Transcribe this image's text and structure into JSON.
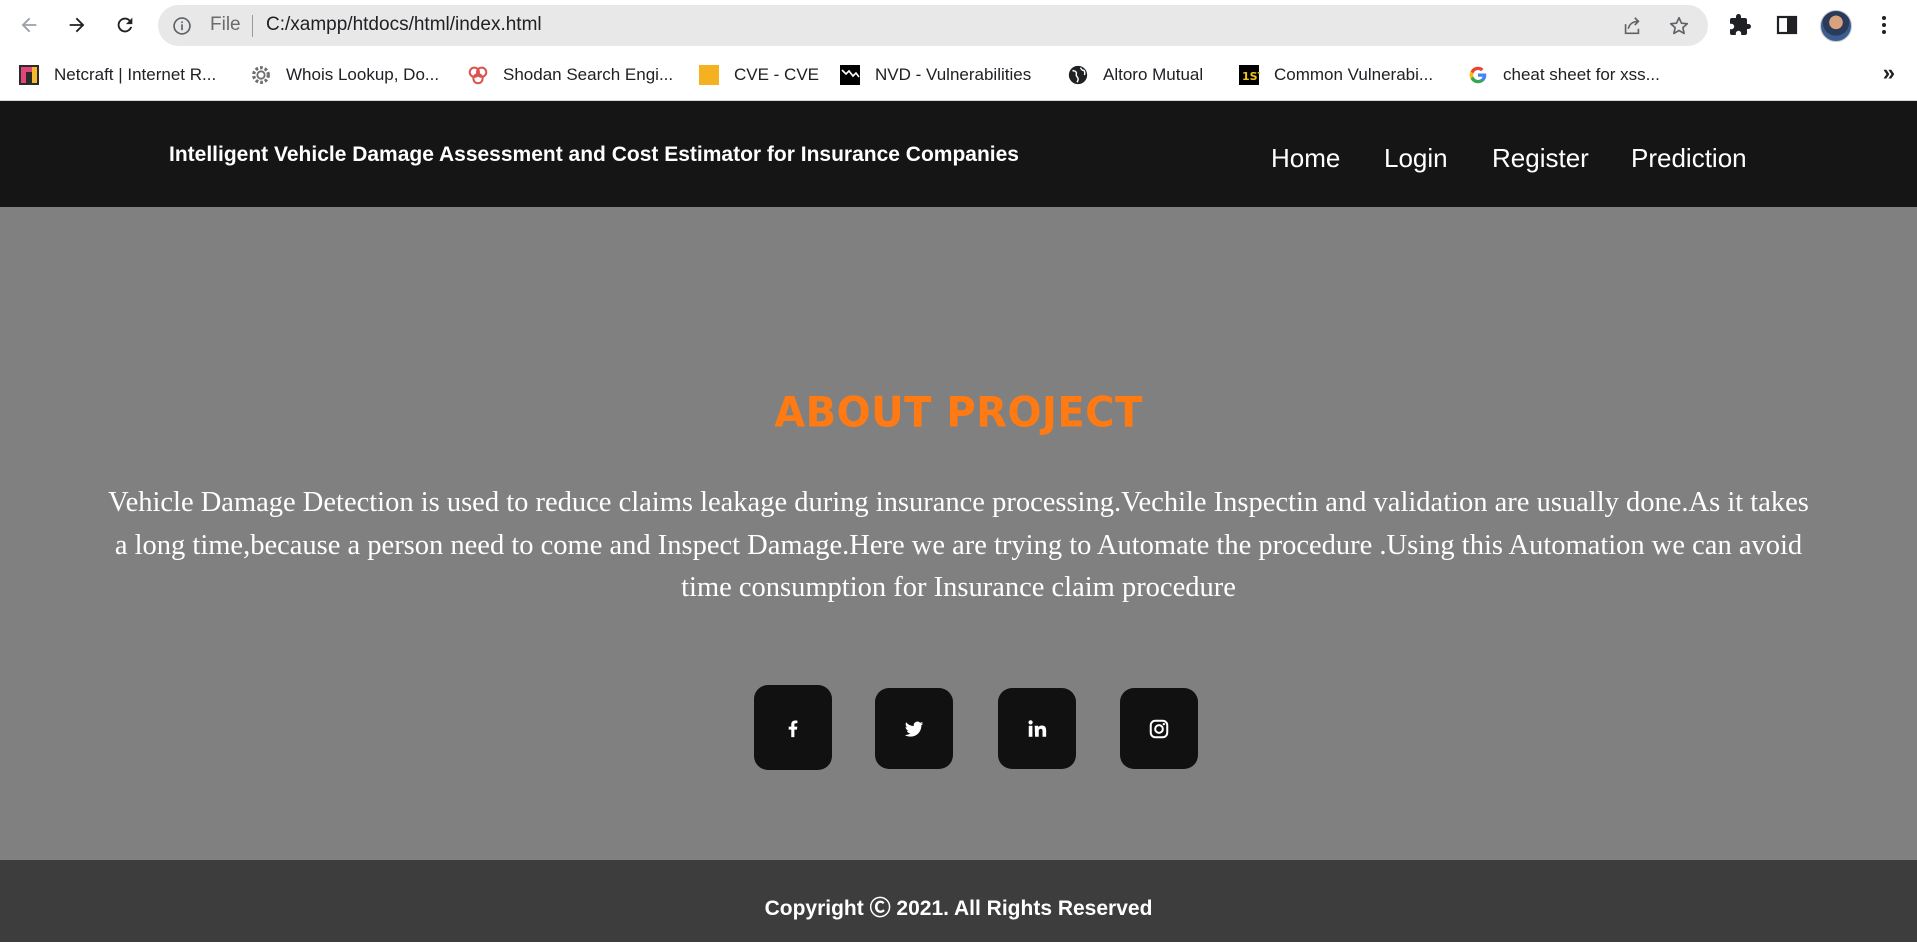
{
  "browser": {
    "url_scheme_label": "File",
    "url": "C:/xampp/htdocs/html/index.html",
    "bookmarks": [
      {
        "label": "Netcraft | Internet R...",
        "icon": "netcraft-icon"
      },
      {
        "label": "Whois Lookup, Do...",
        "icon": "gear-icon"
      },
      {
        "label": "Shodan Search Engi...",
        "icon": "shodan-icon"
      },
      {
        "label": "CVE - CVE",
        "icon": "cve-icon"
      },
      {
        "label": "NVD - Vulnerabilities",
        "icon": "nvd-icon"
      },
      {
        "label": "Altoro Mutual",
        "icon": "globe-icon"
      },
      {
        "label": "Common Vulnerabi...",
        "icon": "first-icon"
      },
      {
        "label": "cheat sheet for xss...",
        "icon": "google-icon"
      }
    ],
    "more_bookmarks": "»"
  },
  "header": {
    "title": "Intelligent Vehicle Damage Assessment and Cost Estimator for Insurance Companies",
    "nav": [
      "Home",
      "Login",
      "Register",
      "Prediction"
    ]
  },
  "about": {
    "heading": "ABOUT PROJECT",
    "text": "Vehicle Damage Detection is used to reduce claims leakage during insurance processing.Vechile Inspectin and validation are usually done.As it takes a long time,because a person need to come and Inspect Damage.Here we are trying to Automate the procedure .Using this Automation we can avoid time consumption for Insurance claim procedure"
  },
  "social": [
    "facebook-icon",
    "twitter-icon",
    "linkedin-icon",
    "instagram-icon"
  ],
  "footer": {
    "copyright": "Copyright Ⓒ 2021. All Rights Reserved"
  },
  "colors": {
    "header_bg": "#151515",
    "hero_bg": "#808080",
    "accent": "#ff7a12",
    "footer_bg": "#3d3d3d",
    "social_bg": "#111111"
  }
}
